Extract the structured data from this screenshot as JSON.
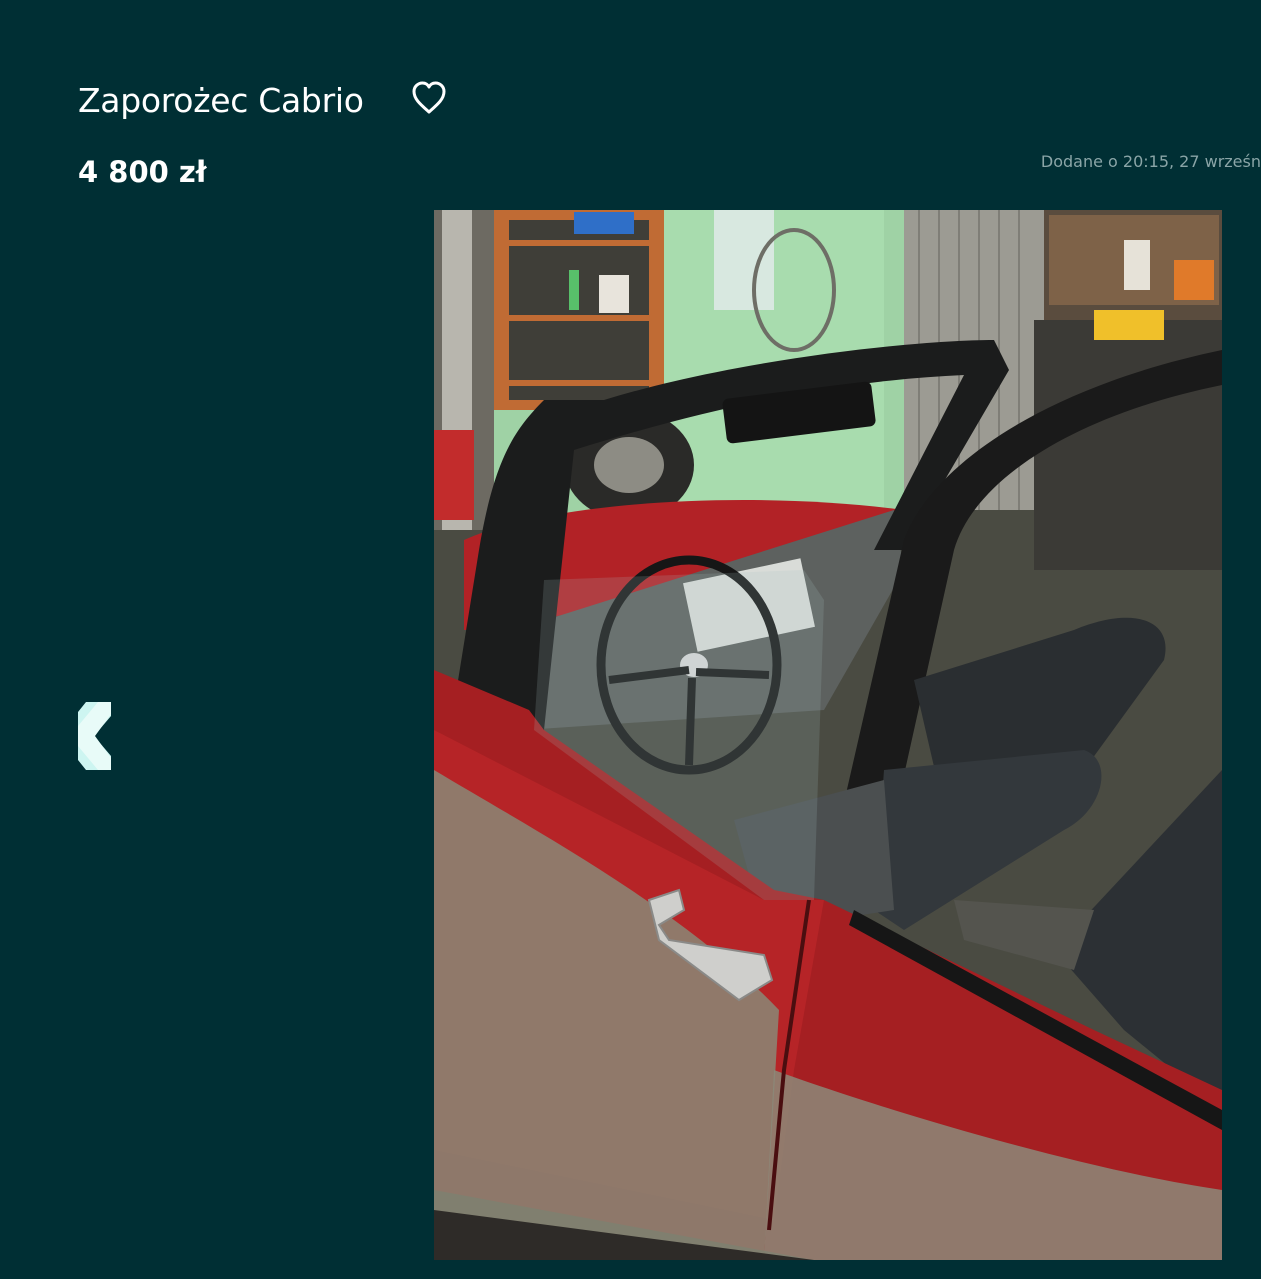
{
  "listing": {
    "title": "Zaporożec Cabrio",
    "price": "4 800 zł",
    "added": "Dodane o 20:15, 27 wrześn"
  },
  "icons": {
    "favorite": "heart-outline-icon",
    "previous": "chevron-left-icon"
  },
  "colors": {
    "background": "#002f34",
    "text": "#ffffff",
    "muted": "#8aa5a7",
    "accent": "#23e5db"
  }
}
